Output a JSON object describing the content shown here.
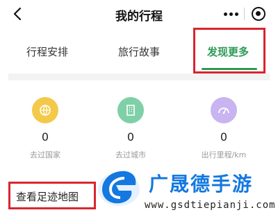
{
  "header": {
    "title": "我的行程"
  },
  "tabs": [
    {
      "label": "行程安排"
    },
    {
      "label": "旅行故事"
    },
    {
      "label": "发现更多"
    }
  ],
  "stats": [
    {
      "value": "0",
      "label": "去过国家",
      "icon": "globe-icon"
    },
    {
      "value": "0",
      "label": "去过城市",
      "icon": "building-icon"
    },
    {
      "value": "0",
      "label": "出行里程/km",
      "icon": "speedometer-icon"
    }
  ],
  "footprint_link": "查看足迹地图",
  "watermark": {
    "title": "广晟德手游",
    "url": "www.gsdtiepianji.com"
  },
  "colors": {
    "accent_green": "#2c9a56",
    "highlight_red": "#d8252f",
    "watermark_blue": "#1478e0"
  }
}
